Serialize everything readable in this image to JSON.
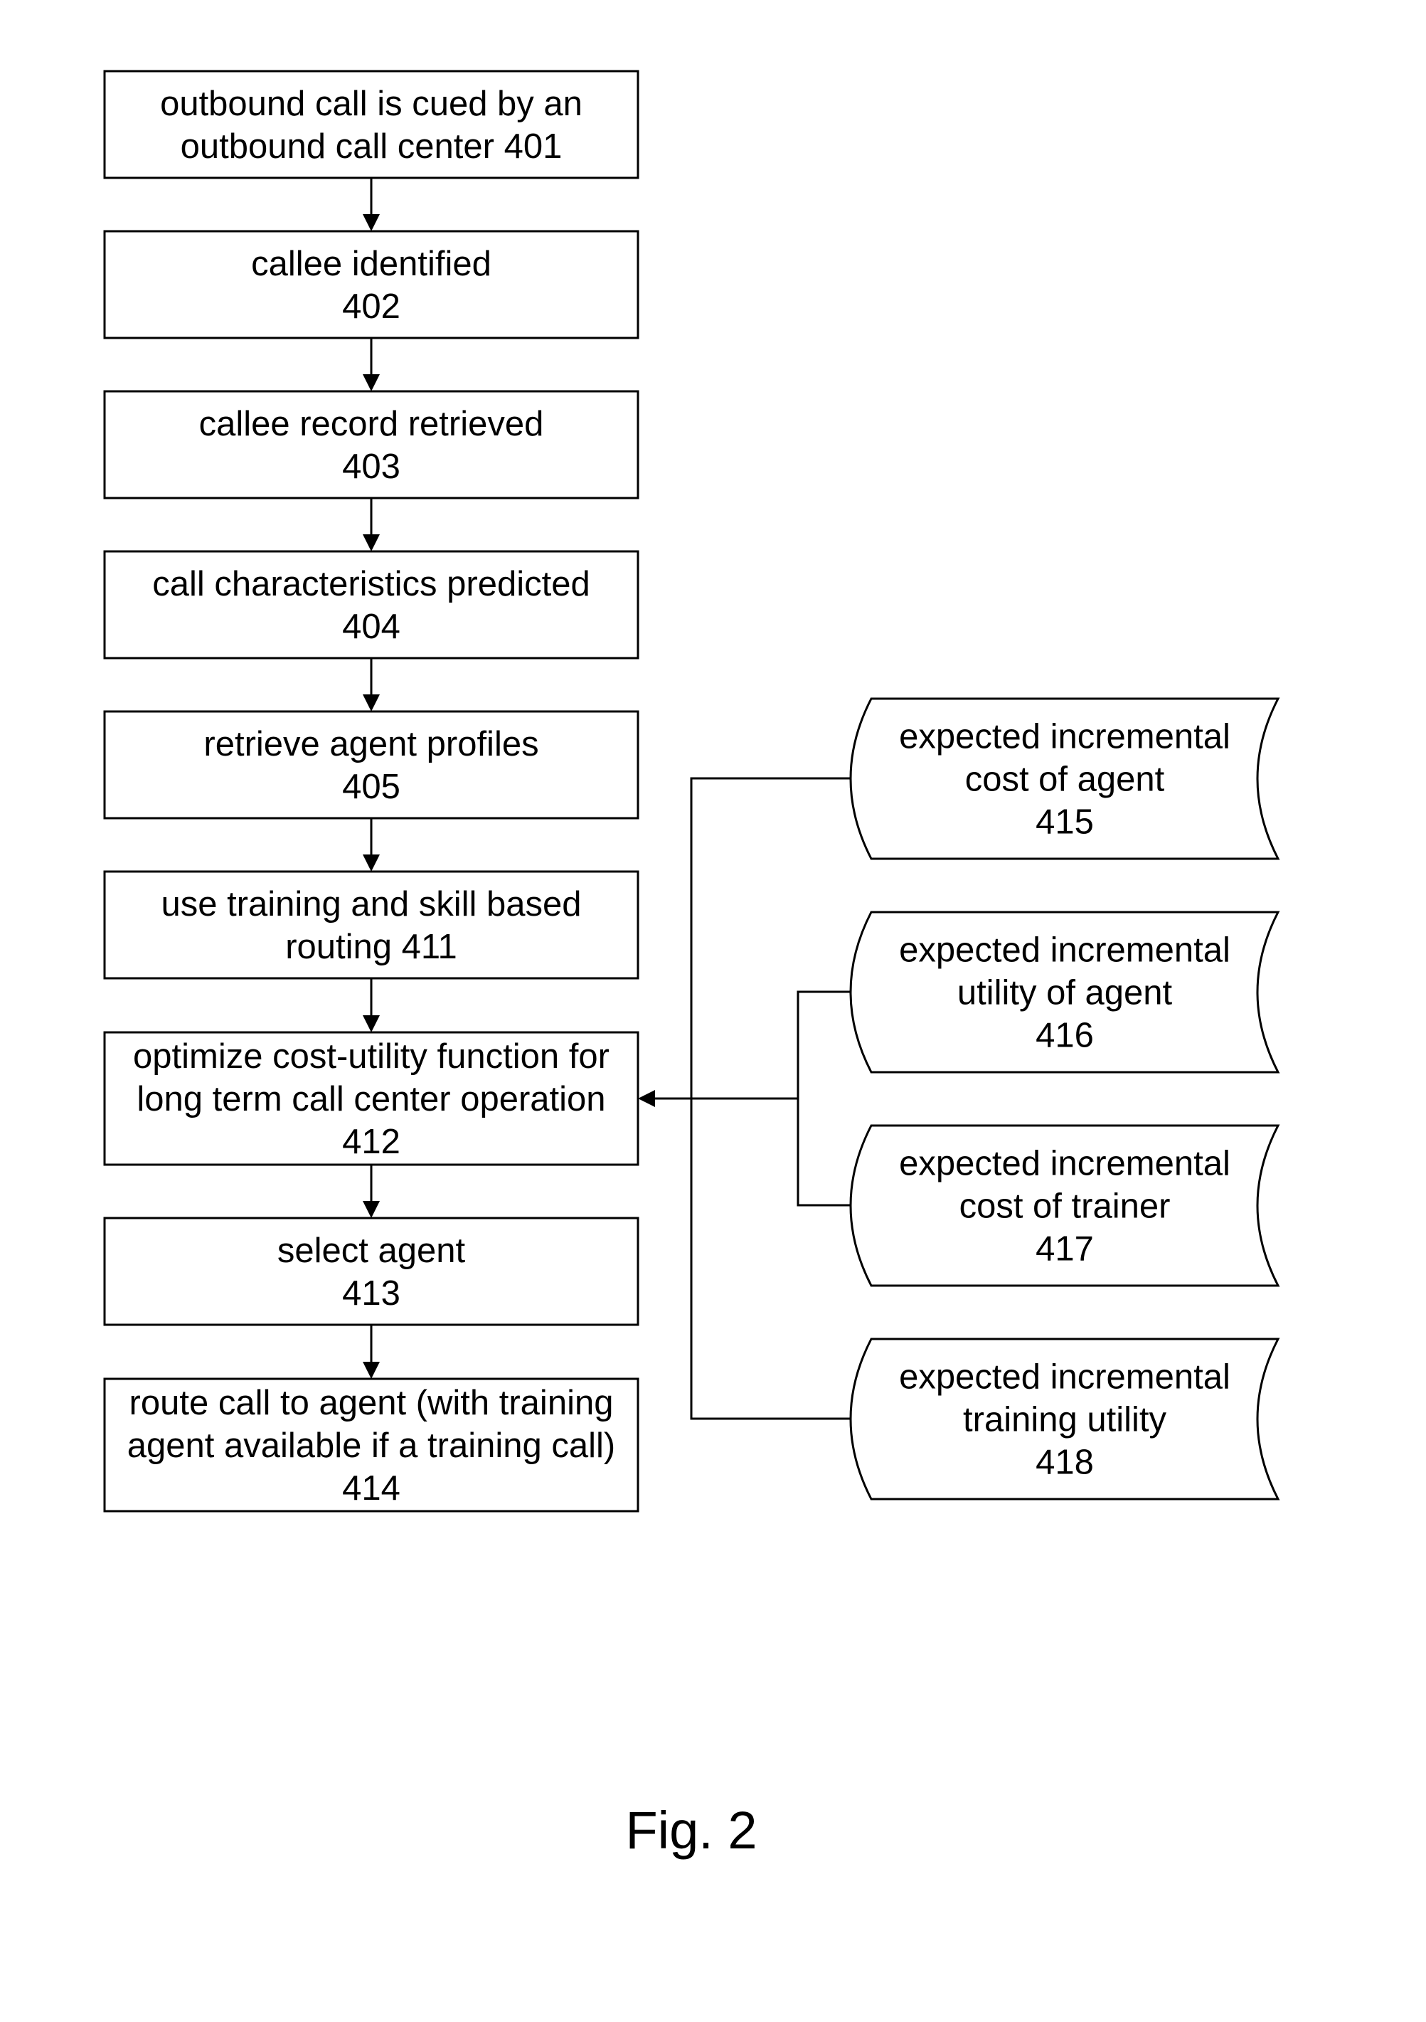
{
  "figure": {
    "caption": "Fig. 2",
    "type": "flowchart"
  },
  "main_steps": [
    {
      "id": "401",
      "lines": [
        "outbound call is cued by an",
        "outbound call center  401"
      ]
    },
    {
      "id": "402",
      "lines": [
        "callee identified",
        "402"
      ]
    },
    {
      "id": "403",
      "lines": [
        "callee record retrieved",
        "403"
      ]
    },
    {
      "id": "404",
      "lines": [
        "call characteristics predicted",
        "404"
      ]
    },
    {
      "id": "405",
      "lines": [
        "retrieve agent profiles",
        "405"
      ]
    },
    {
      "id": "411",
      "lines": [
        "use training and skill based",
        "routing  411"
      ]
    },
    {
      "id": "412",
      "lines": [
        "optimize cost-utility function for",
        "long term call center operation",
        "412"
      ]
    },
    {
      "id": "413",
      "lines": [
        "select agent",
        "413"
      ]
    },
    {
      "id": "414",
      "lines": [
        "route call to agent (with training",
        "agent available if a training call)",
        "414"
      ]
    }
  ],
  "inputs": [
    {
      "id": "415",
      "lines": [
        "expected incremental",
        "cost of agent",
        "415"
      ]
    },
    {
      "id": "416",
      "lines": [
        "expected incremental",
        "utility of agent",
        "416"
      ]
    },
    {
      "id": "417",
      "lines": [
        "expected incremental",
        "cost of trainer",
        "417"
      ]
    },
    {
      "id": "418",
      "lines": [
        "expected incremental",
        "training utility",
        "418"
      ]
    }
  ],
  "edges": [
    {
      "from": "401",
      "to": "402"
    },
    {
      "from": "402",
      "to": "403"
    },
    {
      "from": "403",
      "to": "404"
    },
    {
      "from": "404",
      "to": "405"
    },
    {
      "from": "405",
      "to": "411"
    },
    {
      "from": "411",
      "to": "412"
    },
    {
      "from": "412",
      "to": "413"
    },
    {
      "from": "413",
      "to": "414"
    },
    {
      "from": "415",
      "to": "412"
    },
    {
      "from": "416",
      "to": "412"
    },
    {
      "from": "417",
      "to": "412"
    },
    {
      "from": "418",
      "to": "412"
    }
  ]
}
